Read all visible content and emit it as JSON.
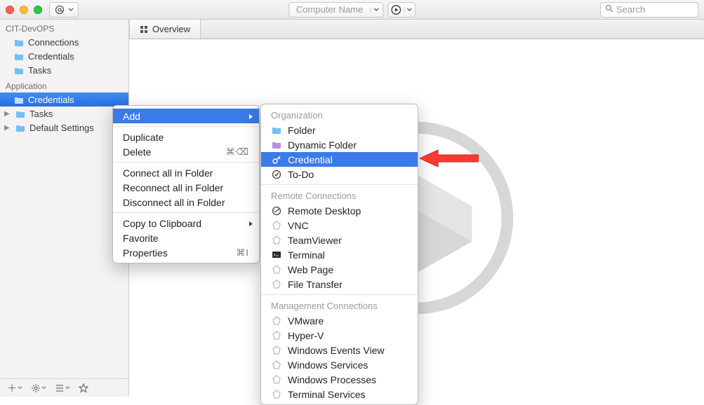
{
  "toolbar": {
    "computer_dropdown_placeholder": "Computer Name",
    "search_placeholder": "Search"
  },
  "tabs": {
    "overview_label": "Overview"
  },
  "sidebar": {
    "group1": "CIT-DevOPS",
    "items1": [
      "Connections",
      "Credentials",
      "Tasks"
    ],
    "group2": "Application",
    "items2": [
      "Credentials",
      "Tasks",
      "Default Settings"
    ]
  },
  "context_menu": {
    "add": "Add",
    "duplicate": "Duplicate",
    "delete": "Delete",
    "delete_shortcut": "⌘⌫",
    "connect_all": "Connect all in Folder",
    "reconnect_all": "Reconnect all in Folder",
    "disconnect_all": "Disconnect all in Folder",
    "copy_clipboard": "Copy to Clipboard",
    "favorite": "Favorite",
    "properties": "Properties",
    "properties_shortcut": "⌘I"
  },
  "submenu": {
    "section_org": "Organization",
    "folder": "Folder",
    "dynamic_folder": "Dynamic Folder",
    "credential": "Credential",
    "todo": "To-Do",
    "section_remote": "Remote Connections",
    "remote_desktop": "Remote Desktop",
    "vnc": "VNC",
    "teamviewer": "TeamViewer",
    "terminal": "Terminal",
    "web_page": "Web Page",
    "file_transfer": "File Transfer",
    "section_mgmt": "Management Connections",
    "vmware": "VMware",
    "hyperv": "Hyper-V",
    "win_events": "Windows Events View",
    "win_services": "Windows Services",
    "win_processes": "Windows Processes",
    "terminal_services": "Terminal Services"
  }
}
